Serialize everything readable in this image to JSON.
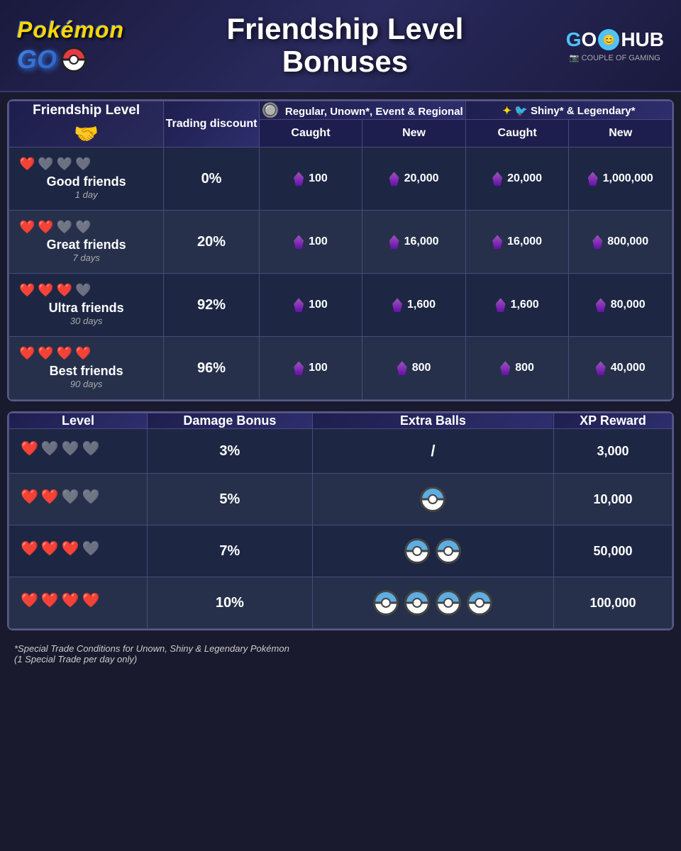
{
  "header": {
    "pokemon_text": "Pokémon",
    "go_text": "GO",
    "title_line1": "Friendship Level",
    "title_line2": "Bonuses",
    "gohub": "GOHUB",
    "couple_of_gaming": "COUPLE OF GAMING"
  },
  "trading_table": {
    "col1_header": "Friendship Level",
    "col2_header": "Trading discount",
    "col3_header": "Regular, Unown*, Event & Regional",
    "col4_header": "Shiny* & Legendary*",
    "subheader_caught": "Caught",
    "subheader_new": "New",
    "rows": [
      {
        "level_name": "Good friends",
        "days": "1 day",
        "hearts_filled": 1,
        "hearts_empty": 3,
        "discount": "0%",
        "regular_caught": "100",
        "regular_new": "20,000",
        "shiny_caught": "20,000",
        "shiny_new": "1,000,000"
      },
      {
        "level_name": "Great friends",
        "days": "7 days",
        "hearts_filled": 2,
        "hearts_empty": 2,
        "discount": "20%",
        "regular_caught": "100",
        "regular_new": "16,000",
        "shiny_caught": "16,000",
        "shiny_new": "800,000"
      },
      {
        "level_name": "Ultra friends",
        "days": "30 days",
        "hearts_filled": 3,
        "hearts_empty": 1,
        "discount": "92%",
        "regular_caught": "100",
        "regular_new": "1,600",
        "shiny_caught": "1,600",
        "shiny_new": "80,000"
      },
      {
        "level_name": "Best friends",
        "days": "90 days",
        "hearts_filled": 4,
        "hearts_empty": 0,
        "discount": "96%",
        "regular_caught": "100",
        "regular_new": "800",
        "shiny_caught": "800",
        "shiny_new": "40,000"
      }
    ]
  },
  "bonus_table": {
    "col1_header": "Level",
    "col2_header": "Damage Bonus",
    "col3_header": "Extra Balls",
    "col4_header": "XP Reward",
    "rows": [
      {
        "hearts_filled": 1,
        "hearts_empty": 3,
        "damage_bonus": "3%",
        "extra_balls": "/",
        "extra_balls_count": 0,
        "xp_reward": "3,000"
      },
      {
        "hearts_filled": 2,
        "hearts_empty": 2,
        "damage_bonus": "5%",
        "extra_balls": "1",
        "extra_balls_count": 1,
        "xp_reward": "10,000"
      },
      {
        "hearts_filled": 3,
        "hearts_empty": 1,
        "damage_bonus": "7%",
        "extra_balls": "2",
        "extra_balls_count": 2,
        "xp_reward": "50,000"
      },
      {
        "hearts_filled": 4,
        "hearts_empty": 0,
        "damage_bonus": "10%",
        "extra_balls": "4",
        "extra_balls_count": 4,
        "xp_reward": "100,000"
      }
    ]
  },
  "footer": {
    "note_line1": "*Special Trade Conditions for Unown, Shiny & Legendary Pokémon",
    "note_line2": "(1 Special Trade per day only)"
  }
}
